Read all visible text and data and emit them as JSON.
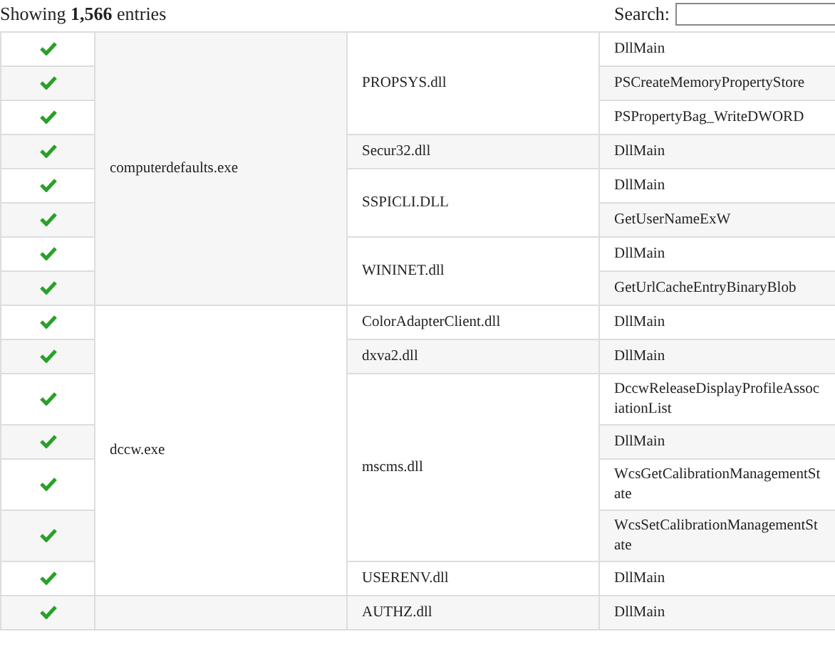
{
  "summary": "Showing **1,566** entries",
  "search": {
    "label": "Search:"
  },
  "groups": [
    {
      "exe": "computerdefaults.exe",
      "dlls": [
        {
          "name": "PROPSYS.dll",
          "functions": [
            {
              "name": "DllMain",
              "checked": true
            },
            {
              "name": "PSCreateMemoryPropertyStore",
              "checked": true
            },
            {
              "name": "PSPropertyBag_WriteDWORD",
              "checked": true
            }
          ]
        },
        {
          "name": "Secur32.dll",
          "functions": [
            {
              "name": "DllMain",
              "checked": true
            }
          ]
        },
        {
          "name": "SSPICLI.DLL",
          "functions": [
            {
              "name": "DllMain",
              "checked": true
            },
            {
              "name": "GetUserNameExW",
              "checked": true
            }
          ]
        },
        {
          "name": "WININET.dll",
          "functions": [
            {
              "name": "DllMain",
              "checked": true
            },
            {
              "name": "GetUrlCacheEntryBinaryBlob",
              "checked": true
            }
          ]
        }
      ]
    },
    {
      "exe": "dccw.exe",
      "dlls": [
        {
          "name": "ColorAdapterClient.dll",
          "functions": [
            {
              "name": "DllMain",
              "checked": true
            }
          ]
        },
        {
          "name": "dxva2.dll",
          "functions": [
            {
              "name": "DllMain",
              "checked": true
            }
          ]
        },
        {
          "name": "mscms.dll",
          "functions": [
            {
              "name": "DccwReleaseDisplayProfileAssociationList",
              "checked": true
            },
            {
              "name": "DllMain",
              "checked": true
            },
            {
              "name": "WcsGetCalibrationManagementState",
              "checked": true
            },
            {
              "name": "WcsSetCalibrationManagementState",
              "checked": true
            }
          ]
        },
        {
          "name": "USERENV.dll",
          "functions": [
            {
              "name": "DllMain",
              "checked": true
            }
          ]
        }
      ]
    },
    {
      "dlls": [
        {
          "name": "AUTHZ.dll",
          "functions": [
            {
              "name": "DllMain",
              "checked": true
            }
          ]
        }
      ]
    }
  ]
}
